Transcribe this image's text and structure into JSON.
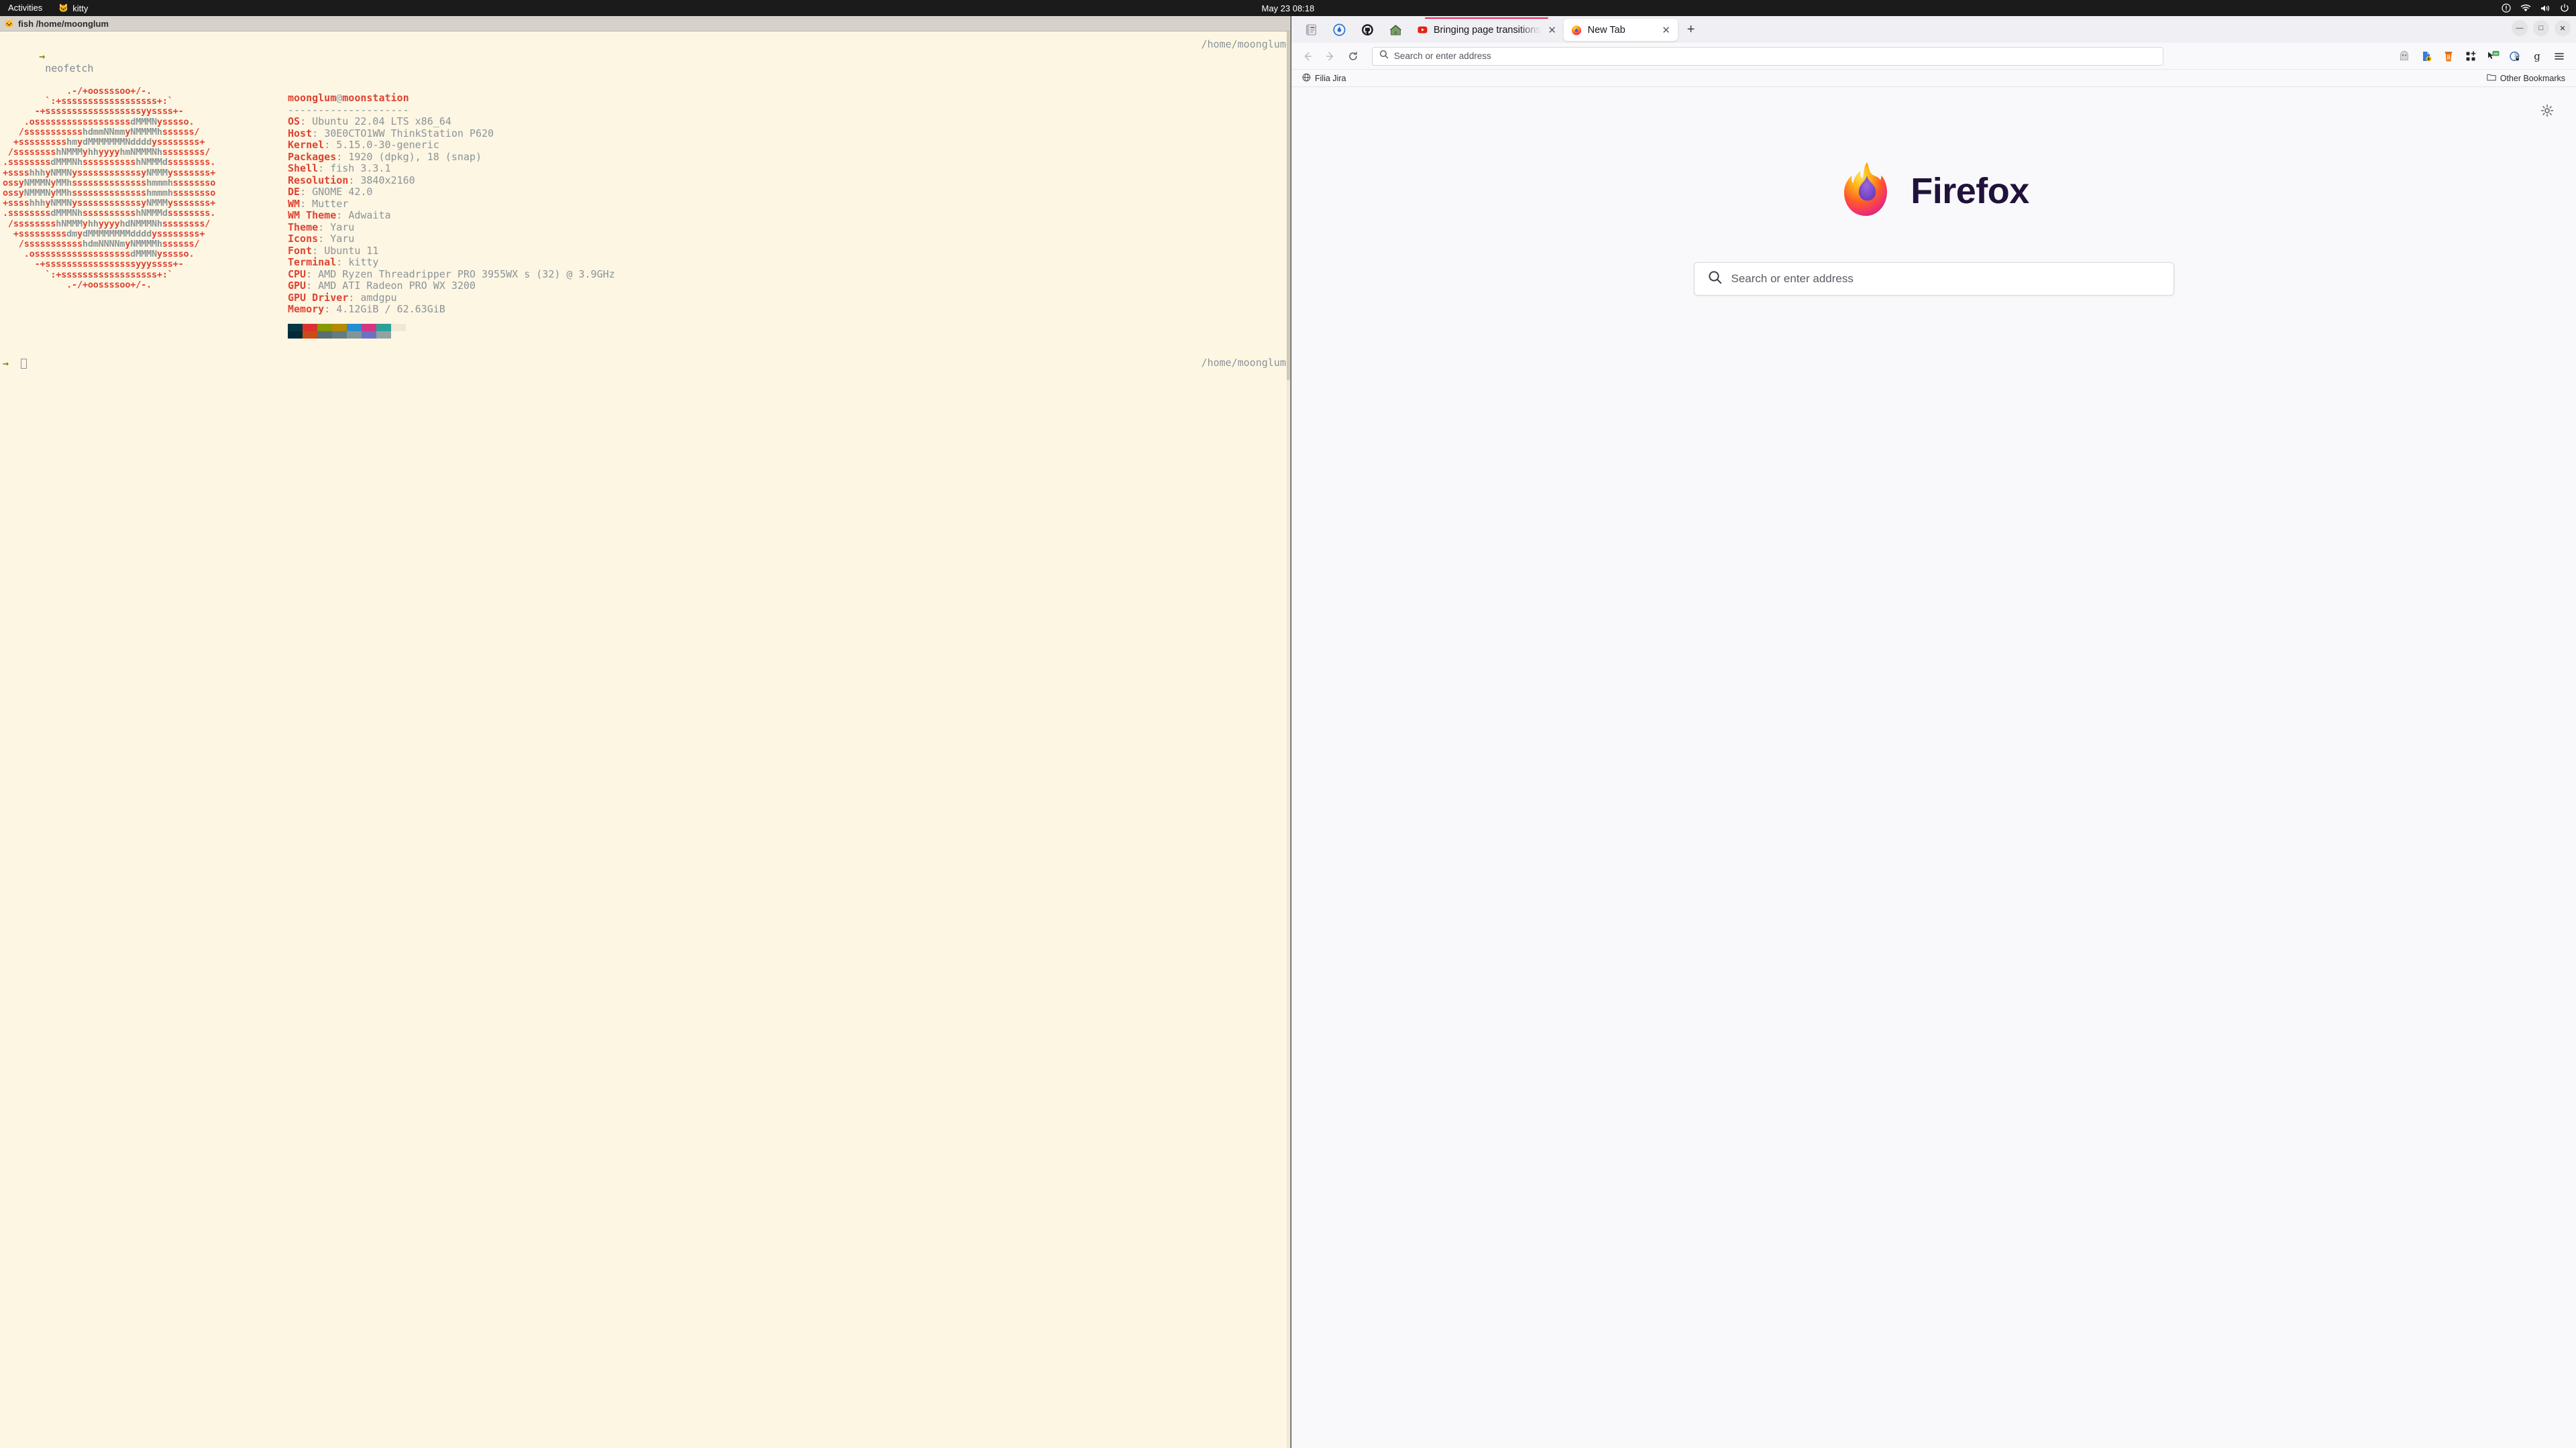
{
  "desktop": {
    "activities_label": "Activities",
    "app_name": "kitty",
    "clock": "May 23  08:18",
    "tray_icons": [
      "recording-indicator-icon",
      "wifi-icon",
      "volume-icon",
      "power-icon"
    ]
  },
  "terminal": {
    "titlebar": "fish /home/moonglum",
    "command": "neofetch",
    "prompt_symbol": "→",
    "right_path_top": "/home/moonglum",
    "right_path_bottom": "/home/moonglum",
    "ascii_logo": [
      "            .-/+oossssoo+/-.",
      "        `:+ssssssssssssssssss+:`",
      "      -+ssssssssssssssssssyyssss+-",
      "    .ossssssssssssssssssdMMMNysssso.",
      "   /ssssssssssshdmmNNmmyNMMMMhssssss/",
      "  +ssssssssshmydMMMMMMMNddddyssssssss+",
      " /sssssssshNMMMyhhyyyyhmNMMMNhssssssss/",
      ".ssssssssdMMMNhsssssssssshNMMMdssssssss.",
      "+sssshhhyNMMNyssssssssssssyNMMMysssssss+",
      "ossyNMMMNyMMhsssssssssssssshmmmhssssssso",
      "ossyNMMMNyMMhsssssssssssssshmmmhssssssso",
      "+sssshhhyNMMNyssssssssssssyNMMMysssssss+",
      ".ssssssssdMMMNhsssssssssshNMMMdssssssss.",
      " /sssssssshNMMMyhhyyyyhdNMMMNhssssssss/",
      "  +sssssssssdmydMMMMMMMMddddyssssssss+",
      "   /ssssssssssshdmNNNNmyNMMMMhssssss/",
      "    .ossssssssssssssssssdMMMNysssso.",
      "      -+sssssssssssssssssyyyssss+-",
      "        `:+ssssssssssssssssss+:`",
      "            .-/+oossssoo+/-."
    ],
    "header": {
      "user": "moonglum",
      "at": "@",
      "host": "moonstation",
      "rule": "--------------------"
    },
    "info": [
      {
        "key": "OS",
        "value": "Ubuntu 22.04 LTS x86_64"
      },
      {
        "key": "Host",
        "value": "30E0CTO1WW ThinkStation P620"
      },
      {
        "key": "Kernel",
        "value": "5.15.0-30-generic"
      },
      {
        "key": "Packages",
        "value": "1920 (dpkg), 18 (snap)"
      },
      {
        "key": "Shell",
        "value": "fish 3.3.1"
      },
      {
        "key": "Resolution",
        "value": "3840x2160"
      },
      {
        "key": "DE",
        "value": "GNOME 42.0"
      },
      {
        "key": "WM",
        "value": "Mutter"
      },
      {
        "key": "WM Theme",
        "value": "Adwaita"
      },
      {
        "key": "Theme",
        "value": "Yaru"
      },
      {
        "key": "Icons",
        "value": "Yaru"
      },
      {
        "key": "Font",
        "value": "Ubuntu 11"
      },
      {
        "key": "Terminal",
        "value": "kitty"
      },
      {
        "key": "CPU",
        "value": "AMD Ryzen Threadripper PRO 3955WX s (32) @ 3.9GHz"
      },
      {
        "key": "GPU",
        "value": "AMD ATI Radeon PRO WX 3200"
      },
      {
        "key": "GPU Driver",
        "value": "amdgpu"
      },
      {
        "key": "Memory",
        "value": "4.12GiB / 62.63GiB"
      }
    ],
    "palette_row1": [
      "#073642",
      "#dc322f",
      "#859900",
      "#b58900",
      "#268bd2",
      "#d33682",
      "#2aa198",
      "#eee8d5"
    ],
    "palette_row2": [
      "#002b36",
      "#cb4b16",
      "#586e75",
      "#657b83",
      "#839496",
      "#6c71c4",
      "#93a1a1",
      "#fdf6e3"
    ],
    "colors": {
      "background": "#fdf6e3",
      "foreground": "#8a9499",
      "accent_red": "#dd4331",
      "prompt_green": "#7a8c00"
    }
  },
  "browser": {
    "pinned_tabs": [
      {
        "name": "pinned-tab-1",
        "icon": "book-icon"
      },
      {
        "name": "pinned-tab-2",
        "icon": "flame-icon"
      },
      {
        "name": "pinned-tab-3",
        "icon": "github-icon"
      },
      {
        "name": "pinned-tab-4",
        "icon": "house-icon"
      }
    ],
    "tabs": [
      {
        "title": "Bringing page transitions",
        "favicon": "youtube-icon",
        "active": false,
        "close_label": "✕"
      },
      {
        "title": "New Tab",
        "favicon": "firefox-icon",
        "active": true,
        "close_label": "✕"
      }
    ],
    "new_tab_label": "+",
    "window_controls": {
      "minimize": "—",
      "maximize": "□",
      "close": "✕"
    },
    "nav": {
      "back_label": "←",
      "forward_label": "→",
      "reload_label": "↻"
    },
    "urlbar": {
      "placeholder": "Search or enter address",
      "value": ""
    },
    "extension_icons": [
      "ghost-icon",
      "file-download-icon",
      "trash-bin-icon",
      "grid-add-icon",
      "pointer-on-icon",
      "shield-lock-icon",
      "grammarly-g-icon"
    ],
    "menu_label": "☰",
    "bookmarks": {
      "items": [
        {
          "label": "Filia Jira",
          "icon": "globe-icon"
        }
      ],
      "other_label": "Other Bookmarks",
      "other_icon": "folder-icon"
    },
    "newtab": {
      "wordmark": "Firefox",
      "search_placeholder": "Search or enter address",
      "search_icon": "search-icon",
      "settings_icon": "gear-icon"
    }
  }
}
